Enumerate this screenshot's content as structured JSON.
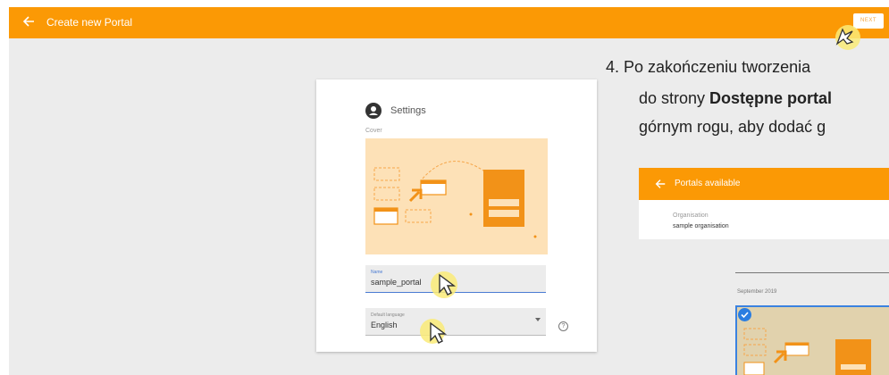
{
  "topbar": {
    "title": "Create new Portal",
    "next_label": "NEXT"
  },
  "settings_card": {
    "title": "Settings",
    "cover_label": "Cover",
    "name_field": {
      "label": "Name",
      "value": "sample_portal"
    },
    "language_field": {
      "label": "Default language",
      "value": "English"
    }
  },
  "instruction": {
    "line1": "4. Po zakończeniu tworzenia",
    "line2_prefix": "do strony ",
    "line2_bold": "Dostępne portal",
    "line3": "górnym rogu, aby dodać g"
  },
  "portals_preview": {
    "title": "Portals available",
    "organisation_label": "Organisation",
    "organisation_value": "sample organisation",
    "date_label": "September 2019"
  },
  "colors": {
    "accent": "#fb9905",
    "cover_bg": "#fde1b7",
    "focus": "#4a7bd3",
    "check": "#2a7de1"
  }
}
